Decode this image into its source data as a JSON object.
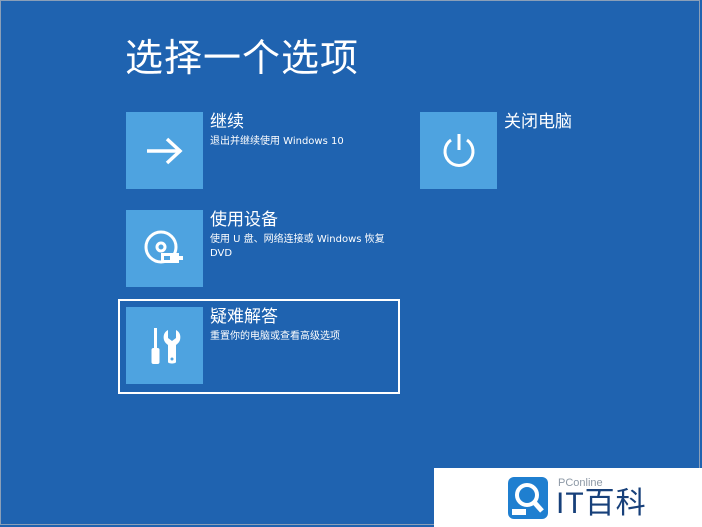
{
  "title": "选择一个选项",
  "options": [
    {
      "label": "继续",
      "desc": "退出并继续使用 Windows 10",
      "icon": "arrow-right-icon"
    },
    {
      "label": "使用设备",
      "desc": "使用 U 盘、网络连接或 Windows 恢复 DVD",
      "icon": "disc-drive-icon"
    },
    {
      "label": "疑难解答",
      "desc": "重置你的电脑或查看高级选项",
      "icon": "tools-icon"
    },
    {
      "label": "关闭电脑",
      "icon": "power-icon"
    }
  ],
  "watermark": {
    "brand": "PConline",
    "name": "IT百科",
    "icon": "magnifier-logo-icon"
  },
  "colors": {
    "background": "#1f63b0",
    "tile": "#4ea3e0",
    "watermark_text": "#17407a"
  }
}
